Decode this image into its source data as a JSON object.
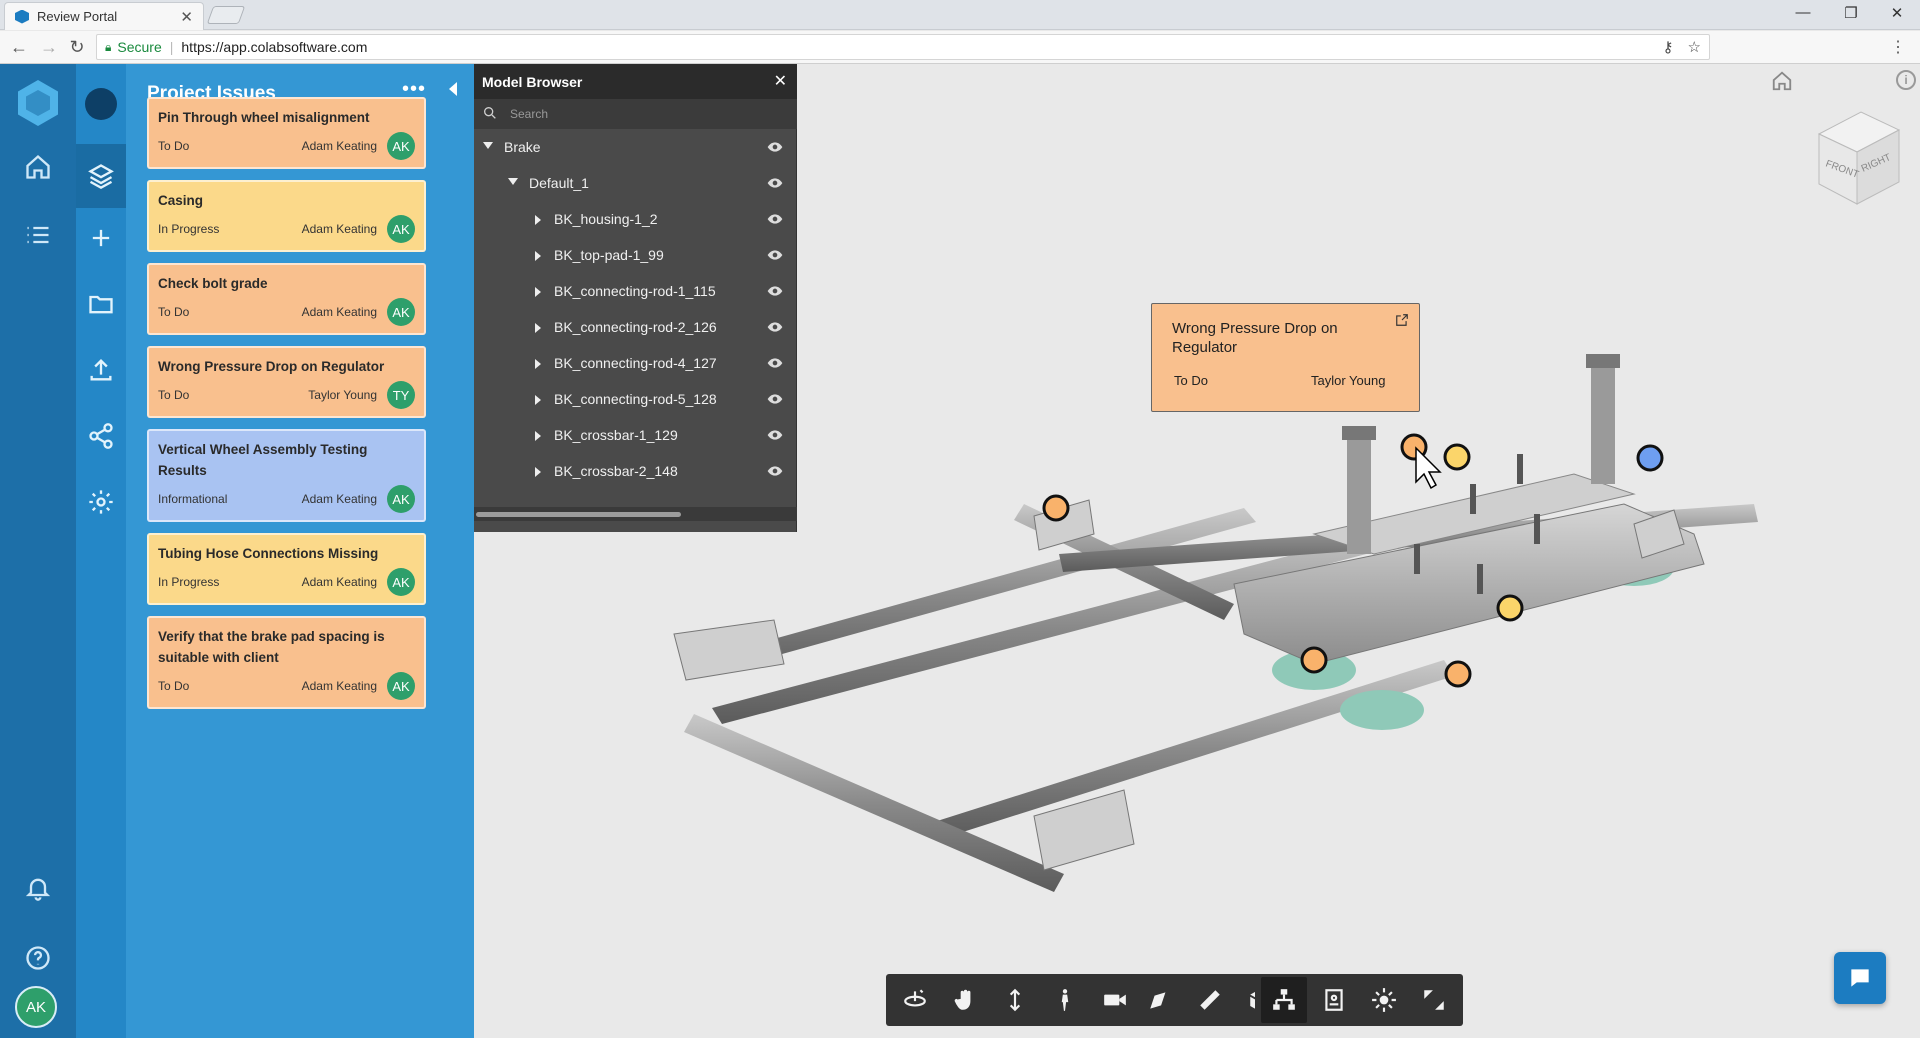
{
  "browser": {
    "tab_title": "Review Portal",
    "tab_close": "✕",
    "secure_label": "Secure",
    "url": "https://app.colabsoftware.com"
  },
  "issues": {
    "title": "Project Issues",
    "more": "•••",
    "cards": [
      {
        "title": "Pin Through wheel misalignment",
        "status": "To Do",
        "assignee": "Adam Keating",
        "initials": "AK",
        "color": "orange"
      },
      {
        "title": "Casing",
        "status": "In Progress",
        "assignee": "Adam Keating",
        "initials": "AK",
        "color": "yellow"
      },
      {
        "title": "Check bolt grade",
        "status": "To Do",
        "assignee": "Adam Keating",
        "initials": "AK",
        "color": "orange"
      },
      {
        "title": "Wrong Pressure Drop on Regulator",
        "status": "To Do",
        "assignee": "Taylor Young",
        "initials": "TY",
        "color": "orange"
      },
      {
        "title": "Vertical Wheel Assembly Testing Results",
        "status": "Informational",
        "assignee": "Adam Keating",
        "initials": "AK",
        "color": "blue"
      },
      {
        "title": "Tubing Hose Connections Missing",
        "status": "In Progress",
        "assignee": "Adam Keating",
        "initials": "AK",
        "color": "yellow"
      },
      {
        "title": "Verify that the brake pad spacing is suitable with client",
        "status": "To Do",
        "assignee": "Adam Keating",
        "initials": "AK",
        "color": "orange"
      }
    ]
  },
  "user": {
    "initials": "AK"
  },
  "model_browser": {
    "title": "Model Browser",
    "close": "✕",
    "search_placeholder": "Search",
    "tree": [
      {
        "label": "Brake",
        "level": 0,
        "expanded": true
      },
      {
        "label": "Default_1",
        "level": 1,
        "expanded": true
      },
      {
        "label": "BK_housing-1_2",
        "level": 2,
        "expanded": false
      },
      {
        "label": "BK_top-pad-1_99",
        "level": 2,
        "expanded": false
      },
      {
        "label": "BK_connecting-rod-1_115",
        "level": 2,
        "expanded": false
      },
      {
        "label": "BK_connecting-rod-2_126",
        "level": 2,
        "expanded": false
      },
      {
        "label": "BK_connecting-rod-4_127",
        "level": 2,
        "expanded": false
      },
      {
        "label": "BK_connecting-rod-5_128",
        "level": 2,
        "expanded": false
      },
      {
        "label": "BK_crossbar-1_129",
        "level": 2,
        "expanded": false
      },
      {
        "label": "BK_crossbar-2_148",
        "level": 2,
        "expanded": false
      }
    ]
  },
  "viewcube": {
    "front": "FRONT",
    "right": "RIGHT"
  },
  "popup": {
    "title": "Wrong Pressure Drop on Regulator",
    "status": "To Do",
    "assignee": "Taylor Young"
  },
  "colors": {
    "orange": "#f9c08e",
    "yellow": "#fbd98a",
    "blue": "#a9c3f2",
    "avatar": "#2e9f6b",
    "accent": "#1c7cc1"
  }
}
